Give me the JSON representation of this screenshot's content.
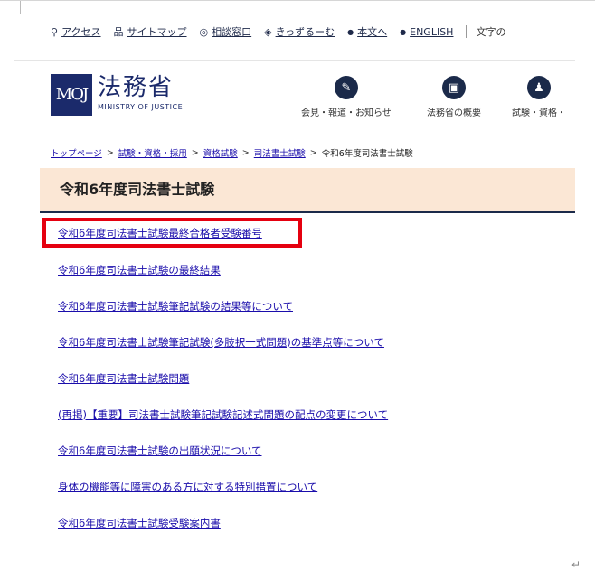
{
  "utility_nav": {
    "items": [
      {
        "icon": "location-pin-icon",
        "glyph": "⚲",
        "label": "アクセス"
      },
      {
        "icon": "sitemap-icon",
        "glyph": "品",
        "label": "サイトマップ"
      },
      {
        "icon": "chat-bubble-icon",
        "glyph": "◎",
        "label": "相談窓口"
      },
      {
        "icon": "mascot-icon",
        "glyph": "◈",
        "label": "きっずるーむ"
      },
      {
        "icon": "bullet-icon",
        "glyph": "●",
        "label": "本文へ"
      },
      {
        "icon": "bullet-icon",
        "glyph": "●",
        "label": "ENGLISH"
      }
    ],
    "text_size_label": "文字の"
  },
  "logo": {
    "mark": "MOJ",
    "kanji": "法務省",
    "english": "MINISTRY OF JUSTICE"
  },
  "global_nav": [
    {
      "icon": "microphone-icon",
      "glyph": "✎",
      "label": "会見・報道・お知らせ"
    },
    {
      "icon": "building-icon",
      "glyph": "▣",
      "label": "法務省の概要"
    },
    {
      "icon": "people-icon",
      "glyph": "♟",
      "label": "試験・資格・"
    }
  ],
  "breadcrumb": {
    "items": [
      "トップページ",
      "試験・資格・採用",
      "資格試験",
      "司法書士試験"
    ],
    "current": "令和6年度司法書士試験"
  },
  "page": {
    "title": "令和6年度司法書士試験"
  },
  "links": [
    "令和6年度司法書士試験最終合格者受験番号",
    "令和6年度司法書士試験の最終結果",
    "令和6年度司法書士試験筆記試験の結果等について",
    "令和6年度司法書士試験筆記試験(多肢択一式問題)の基準点等について",
    "令和6年度司法書士試験問題",
    "(再掲)【重要】司法書士試験筆記試験記述式問題の配点の変更について",
    "令和6年度司法書士試験の出願状況について",
    "身体の機能等に障害のある方に対する特別措置について",
    "令和6年度司法書士試験受験案内書"
  ],
  "colors": {
    "highlight": "#e5000f",
    "title_band": "#fbe7d5",
    "brand": "#1b2a6b",
    "link": "#1a0dab"
  },
  "return_glyph": "↵"
}
